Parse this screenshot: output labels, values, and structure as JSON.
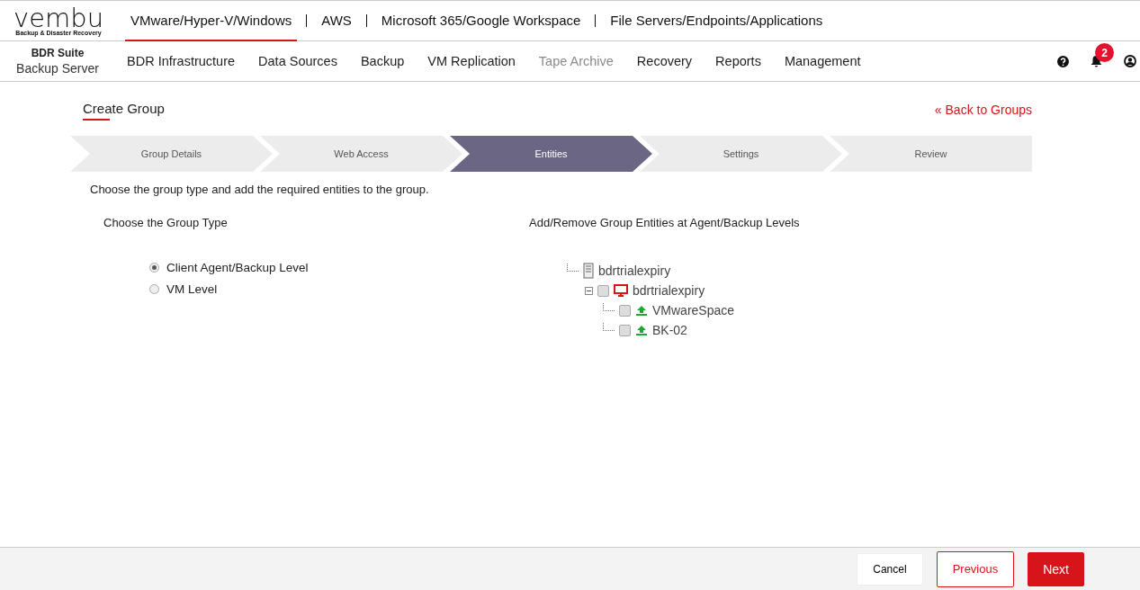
{
  "logo": {
    "wordmark": "vembu",
    "tagline": "Backup & Disaster Recovery"
  },
  "product_tabs": [
    {
      "label": "VMware/Hyper-V/Windows",
      "selected": true
    },
    {
      "label": "AWS",
      "selected": false
    },
    {
      "label": "Microsoft 365/Google Workspace",
      "selected": false
    },
    {
      "label": "File Servers/Endpoints/Applications",
      "selected": false
    }
  ],
  "product": {
    "suite": "BDR Suite",
    "server": "Backup Server"
  },
  "nav": [
    {
      "label": "BDR Infrastructure",
      "disabled": false
    },
    {
      "label": "Data Sources",
      "disabled": false
    },
    {
      "label": "Backup",
      "disabled": false
    },
    {
      "label": "VM Replication",
      "disabled": false
    },
    {
      "label": "Tape Archive",
      "disabled": true
    },
    {
      "label": "Recovery",
      "disabled": false
    },
    {
      "label": "Reports",
      "disabled": false
    },
    {
      "label": "Management",
      "disabled": false
    }
  ],
  "notifications_badge": "2",
  "page_title": "Create Group",
  "back_link": "« Back to Groups",
  "steps": [
    {
      "label": "Group Details",
      "selected": false
    },
    {
      "label": "Web Access",
      "selected": false
    },
    {
      "label": "Entities",
      "selected": true
    },
    {
      "label": "Settings",
      "selected": false
    },
    {
      "label": "Review",
      "selected": false
    }
  ],
  "instruction": "Choose the group type and add the required entities to the group.",
  "group_type": {
    "heading": "Choose the Group Type",
    "options": [
      {
        "label": "Client Agent/Backup Level",
        "selected": true
      },
      {
        "label": "VM Level",
        "selected": false
      }
    ]
  },
  "entities": {
    "heading": "Add/Remove Group Entities at Agent/Backup Levels",
    "tree": [
      {
        "label": "bdrtrialexpiry",
        "kind": "server",
        "children": [
          {
            "label": "bdrtrialexpiry",
            "kind": "desktop",
            "checked": false,
            "expanded": true,
            "children": [
              {
                "label": "VMwareSpace",
                "kind": "backup",
                "checked": false
              },
              {
                "label": "BK-02",
                "kind": "backup",
                "checked": false
              }
            ]
          }
        ]
      }
    ]
  },
  "buttons": [
    {
      "label": "Cancel",
      "kind": "plain"
    },
    {
      "label": "Previous",
      "kind": "outline"
    },
    {
      "label": "Next",
      "kind": "primary"
    }
  ]
}
